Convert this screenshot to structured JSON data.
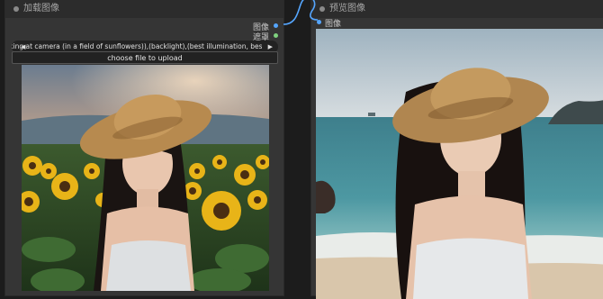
{
  "load_node": {
    "title": "加载图像",
    "outputs": [
      {
        "label": "图像",
        "color": "#55a6ff"
      },
      {
        "label": "遮罩",
        "color": "#7fd27f"
      }
    ],
    "image_filename": "ooking at camera (in a field of sunflowers)),(backlight),(best illumination, best shadow, an extremely.png",
    "upload_button_label": "choose file to upload"
  },
  "preview_node": {
    "title": "预览图像",
    "inputs": [
      {
        "label": "图像"
      }
    ]
  },
  "icons": {
    "combo_left": "◀",
    "combo_right": "▶"
  },
  "colors": {
    "canvas_bg": "#1c1c1c",
    "node_bg": "#353535",
    "wire": "#55a6ff"
  }
}
